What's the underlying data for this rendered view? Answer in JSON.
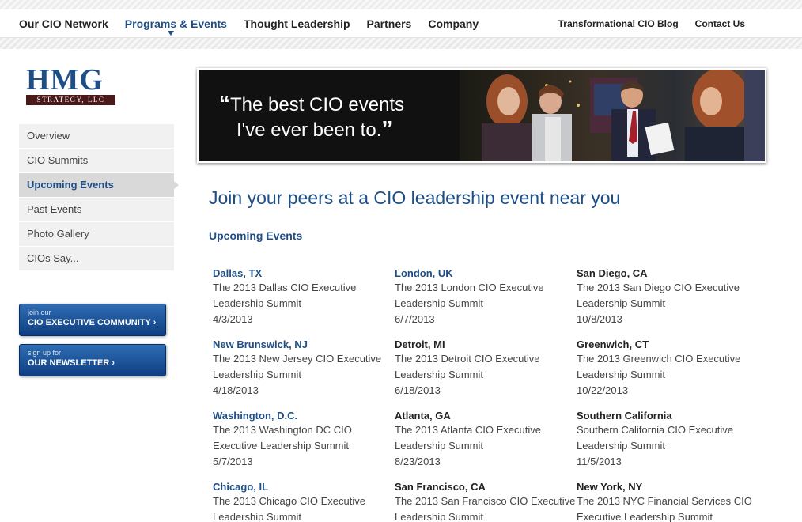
{
  "nav": {
    "main": [
      "Our CIO Network",
      "Programs & Events",
      "Thought Leadership",
      "Partners",
      "Company"
    ],
    "active_index": 1,
    "right": [
      "Transformational CIO Blog",
      "Contact Us"
    ]
  },
  "logo": {
    "text": "HMG",
    "subtitle": "STRATEGY, LLC"
  },
  "sidebar": {
    "items": [
      "Overview",
      "CIO Summits",
      "Upcoming Events",
      "Past Events",
      "Photo Gallery",
      "CIOs Say..."
    ],
    "active_index": 2
  },
  "cta": {
    "community": {
      "small": "join our",
      "big": "CIO EXECUTIVE COMMUNITY ›"
    },
    "newsletter": {
      "small": "sign up for",
      "big": "OUR NEWSLETTER ›"
    }
  },
  "banner": {
    "quote_line1": "The best CIO events",
    "quote_line2": "I've ever been to."
  },
  "main": {
    "headline": "Join your peers at a CIO leadership event near you",
    "subhead": "Upcoming Events"
  },
  "events": [
    {
      "city": "Dallas, TX",
      "name": "The 2013 Dallas CIO Executive Leadership Summit",
      "date": "4/3/2013",
      "blue": true
    },
    {
      "city": "London, UK",
      "name": "The 2013 London CIO Executive Leadership Summit",
      "date": "6/7/2013",
      "blue": true
    },
    {
      "city": "San Diego, CA",
      "name": "The 2013 San Diego CIO Executive Leadership Summit",
      "date": "10/8/2013",
      "blue": false
    },
    {
      "city": "New Brunswick, NJ",
      "name": "The 2013 New Jersey CIO Executive Leadership Summit",
      "date": "4/18/2013",
      "blue": true
    },
    {
      "city": "Detroit, MI",
      "name": "The 2013 Detroit CIO Executive Leadership Summit",
      "date": "6/18/2013",
      "blue": false
    },
    {
      "city": "Greenwich, CT",
      "name": "The 2013 Greenwich CIO Executive Leadership Summit",
      "date": "10/22/2013",
      "blue": false
    },
    {
      "city": "Washington, D.C.",
      "name": "The 2013 Washington DC CIO Executive Leadership Summit",
      "date": "5/7/2013",
      "blue": true
    },
    {
      "city": "Atlanta, GA",
      "name": "The 2013 Atlanta CIO Executive Leadership Summit",
      "date": "8/23/2013",
      "blue": false
    },
    {
      "city": "Southern California",
      "name": "Southern California CIO Executive Leadership Summit",
      "date": "11/5/2013",
      "blue": false
    },
    {
      "city": "Chicago, IL",
      "name": "The 2013 Chicago CIO Executive Leadership Summit",
      "date": "",
      "blue": true
    },
    {
      "city": "San Francisco, CA",
      "name": "The 2013 San Francisco CIO Executive Leadership Summit",
      "date": "",
      "blue": false
    },
    {
      "city": "New York, NY",
      "name": "The 2013 NYC Financial Services CIO Executive Leadership Summit",
      "date": "",
      "blue": false
    }
  ]
}
